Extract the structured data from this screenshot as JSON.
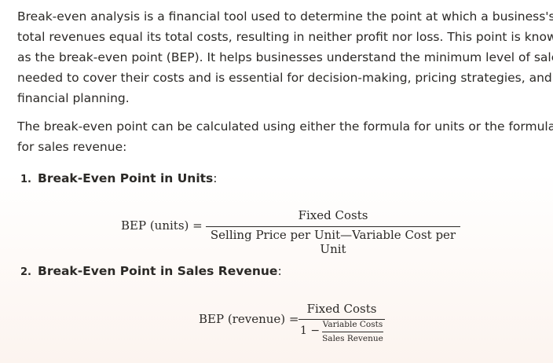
{
  "intro": {
    "lines": [
      "Break-even analysis is a financial tool used to determine the point at which a business's",
      "total revenues equal its total costs, resulting in neither profit nor loss. This point is known",
      "as the break-even point (BEP). It helps businesses understand the minimum level of sales",
      "needed to cover their costs and is essential for decision-making, pricing strategies, and",
      "financial planning."
    ]
  },
  "methods": {
    "lines": [
      "The break-even point can be calculated using either the formula for units or the formula",
      "for sales revenue:"
    ]
  },
  "list": [
    {
      "number": "1.",
      "title": "Break-Even Point in Units",
      "suffix": ":",
      "formula": {
        "lhs": "BEP (units) =",
        "numerator": "Fixed Costs",
        "denominator": "Selling Price per Unit—Variable Cost per Unit"
      }
    },
    {
      "number": "2.",
      "title": "Break-Even Point in Sales Revenue",
      "suffix": ":",
      "formula": {
        "lhs": "BEP (revenue) =",
        "numerator": "Fixed Costs",
        "denominator_prefix": "1 −",
        "inner_numerator": "Variable Costs",
        "inner_denominator": "Sales Revenue"
      }
    }
  ]
}
